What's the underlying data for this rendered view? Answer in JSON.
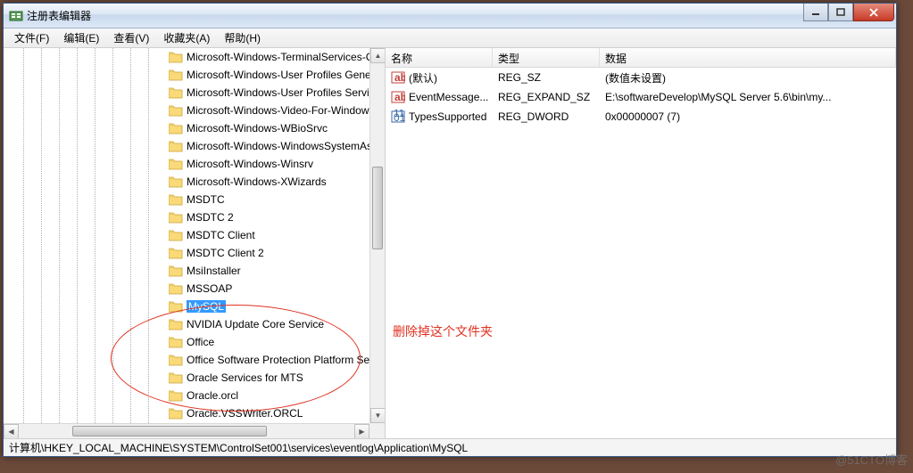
{
  "window": {
    "title": "注册表编辑器"
  },
  "menu": {
    "file": "文件(F)",
    "edit": "编辑(E)",
    "view": "查看(V)",
    "favorites": "收藏夹(A)",
    "help": "帮助(H)"
  },
  "tree": {
    "items": [
      {
        "label": "Microsoft-Windows-TerminalServices-C"
      },
      {
        "label": "Microsoft-Windows-User Profiles Gene"
      },
      {
        "label": "Microsoft-Windows-User Profiles Servic"
      },
      {
        "label": "Microsoft-Windows-Video-For-Window"
      },
      {
        "label": "Microsoft-Windows-WBioSrvc"
      },
      {
        "label": "Microsoft-Windows-WindowsSystemAs"
      },
      {
        "label": "Microsoft-Windows-Winsrv"
      },
      {
        "label": "Microsoft-Windows-XWizards"
      },
      {
        "label": "MSDTC"
      },
      {
        "label": "MSDTC 2"
      },
      {
        "label": "MSDTC Client"
      },
      {
        "label": "MSDTC Client 2"
      },
      {
        "label": "MsiInstaller"
      },
      {
        "label": "MSSOAP"
      },
      {
        "label": "MySQL",
        "selected": true
      },
      {
        "label": "NVIDIA Update Core Service"
      },
      {
        "label": "Office"
      },
      {
        "label": "Office Software Protection Platform Ser"
      },
      {
        "label": "Oracle Services for MTS"
      },
      {
        "label": "Oracle.orcl"
      },
      {
        "label": "Oracle.VSSWriter.ORCL"
      }
    ]
  },
  "list": {
    "headers": {
      "name": "名称",
      "type": "类型",
      "data": "数据"
    },
    "rows": [
      {
        "icon": "str",
        "name": "(默认)",
        "type": "REG_SZ",
        "data": "(数值未设置)"
      },
      {
        "icon": "str",
        "name": "EventMessage...",
        "type": "REG_EXPAND_SZ",
        "data": "E:\\softwareDevelop\\MySQL Server 5.6\\bin\\my..."
      },
      {
        "icon": "bin",
        "name": "TypesSupported",
        "type": "REG_DWORD",
        "data": "0x00000007 (7)"
      }
    ]
  },
  "status": {
    "path": "计算机\\HKEY_LOCAL_MACHINE\\SYSTEM\\ControlSet001\\services\\eventlog\\Application\\MySQL"
  },
  "annotation": "删除掉这个文件夹",
  "watermark": "@51CTO博客"
}
